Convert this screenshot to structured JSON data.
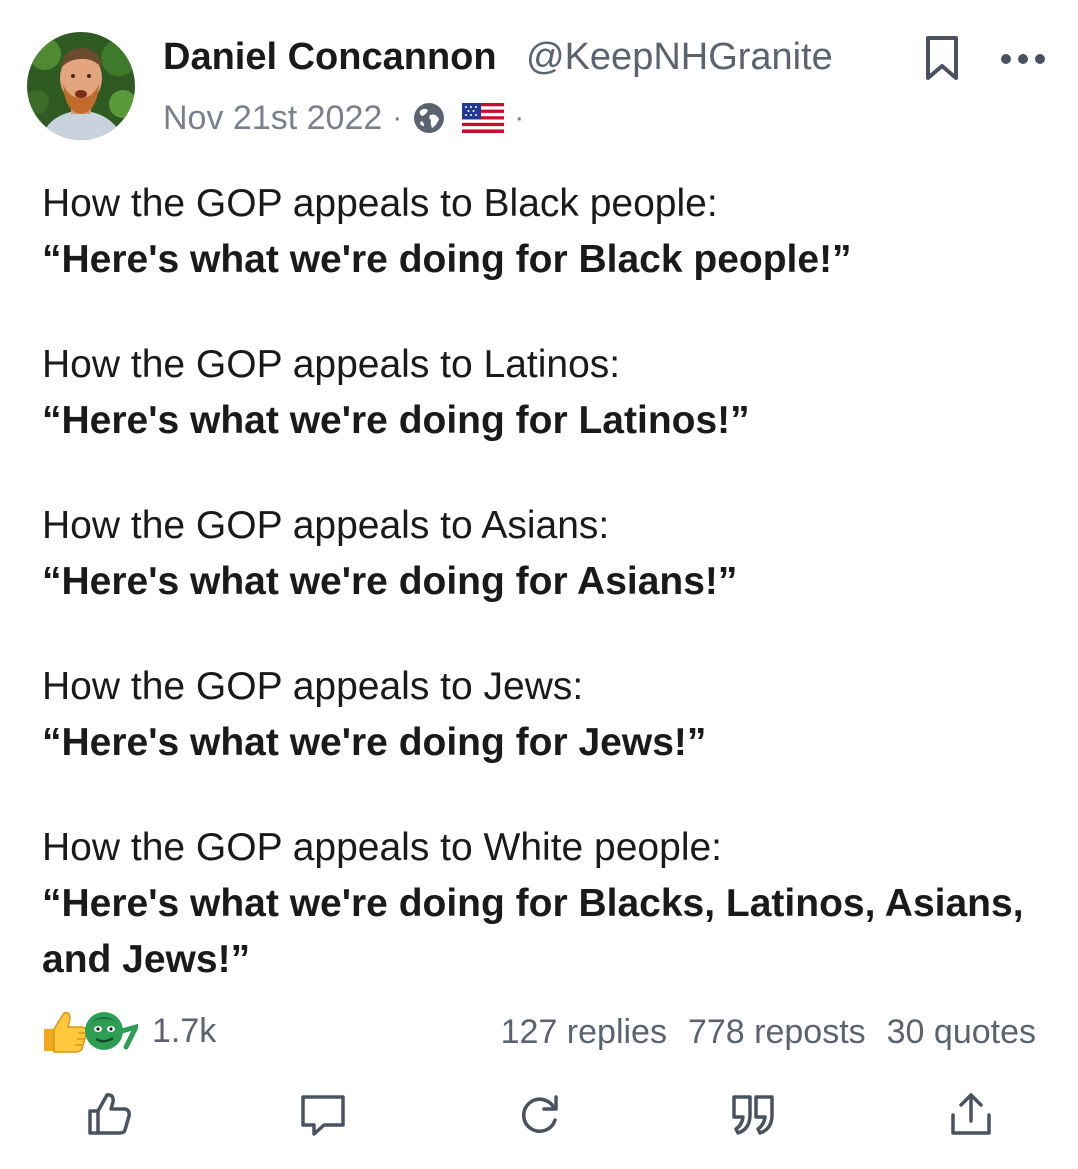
{
  "post": {
    "author": {
      "display_name": "Daniel Concannon",
      "handle": "@KeepNHGranite"
    },
    "date": "Nov 21st 2022",
    "meta_separator": "·",
    "visibility_icon": "globe-icon",
    "flag_icon": "us-flag-icon",
    "paragraphs": [
      {
        "plain": "How the GOP appeals to Black people:",
        "bold": "“Here's what we're doing for Black people!”"
      },
      {
        "plain": "How the GOP appeals to Latinos:",
        "bold": "“Here's what we're doing for Latinos!”"
      },
      {
        "plain": "How the GOP appeals to Asians:",
        "bold": "“Here's what we're doing for Asians!”"
      },
      {
        "plain": "How the GOP appeals to Jews:",
        "bold": "“Here's what we're doing for Jews!”"
      },
      {
        "plain": "How the GOP appeals to White people:",
        "bold": "“Here's what we're doing for Blacks, Latinos, Asians, and Jews!”"
      }
    ],
    "reactions": {
      "count": "1.7k",
      "icons": [
        "thumbs-up-emoji",
        "green-face-emoji"
      ]
    },
    "stats": {
      "replies": "127 replies",
      "reposts": "778 reposts",
      "quotes": "30 quotes"
    },
    "actions": [
      "like-icon",
      "reply-icon",
      "repost-icon",
      "quote-icon",
      "share-icon"
    ]
  },
  "colors": {
    "text": "#1a1a1a",
    "muted": "#5b6270",
    "icon": "#4a5262"
  }
}
